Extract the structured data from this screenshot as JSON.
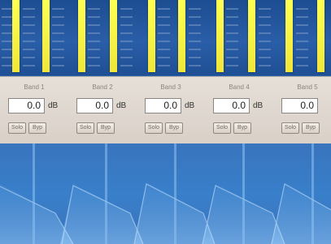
{
  "bands": [
    {
      "label": "Band 1",
      "gain": "0.0",
      "unit": "dB",
      "solo": "Solo",
      "bypass": "Byp"
    },
    {
      "label": "Band 2",
      "gain": "0.0",
      "unit": "dB",
      "solo": "Solo",
      "bypass": "Byp"
    },
    {
      "label": "Band 3",
      "gain": "0.0",
      "unit": "dB",
      "solo": "Solo",
      "bypass": "Byp"
    },
    {
      "label": "Band 4",
      "gain": "0.0",
      "unit": "dB",
      "solo": "Solo",
      "bypass": "Byp"
    },
    {
      "label": "Band 5",
      "gain": "0.0",
      "unit": "",
      "solo": "Solo",
      "bypass": "Byp"
    }
  ],
  "colors": {
    "meter": "#ffff54",
    "panel": "#e6dfd8",
    "graph": "#397fca"
  }
}
